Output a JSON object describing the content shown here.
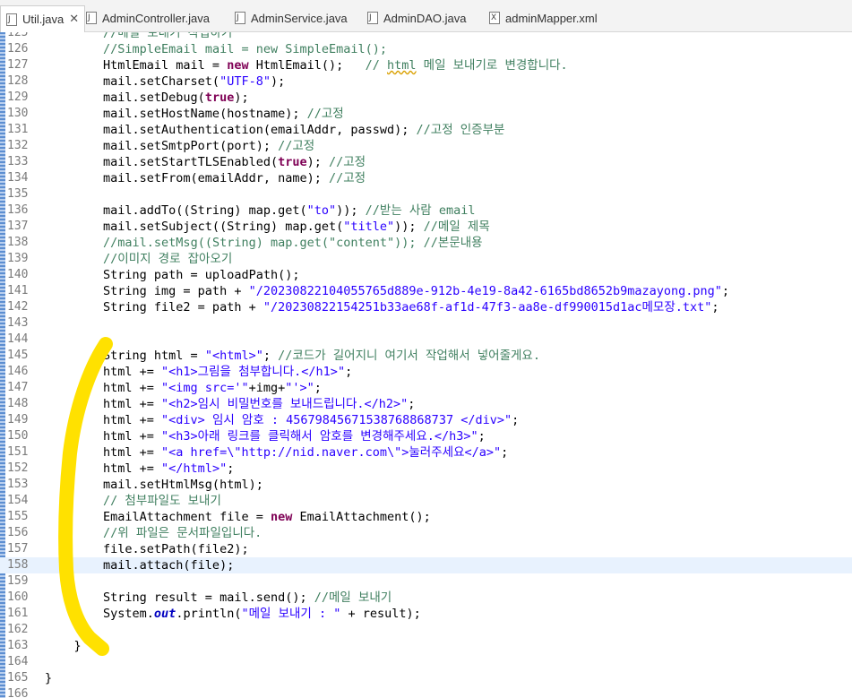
{
  "tabs": [
    {
      "label": "Util.java",
      "icon": "java-file-icon",
      "active": true
    },
    {
      "label": "AdminController.java",
      "icon": "java-file-icon"
    },
    {
      "label": "AdminService.java",
      "icon": "java-file-icon"
    },
    {
      "label": "AdminDAO.java",
      "icon": "java-file-icon"
    },
    {
      "label": "adminMapper.xml",
      "icon": "xml-file-icon"
    }
  ],
  "tab_close_glyph": "✕",
  "annotation": {
    "color": "#ffe100",
    "type": "freehand-yellow-arc"
  },
  "lines": [
    {
      "n": "125",
      "t": "        //메일 보내기 작업하기"
    },
    {
      "n": "126",
      "t": "        //SimpleEmail mail = new SimpleEmail();"
    },
    {
      "n": "127",
      "t": "        HtmlEmail mail = new HtmlEmail();   // html 메일 보내기로 변경합니다."
    },
    {
      "n": "128",
      "t": "        mail.setCharset(\"UTF-8\");"
    },
    {
      "n": "129",
      "t": "        mail.setDebug(true);"
    },
    {
      "n": "130",
      "t": "        mail.setHostName(hostname); //고정"
    },
    {
      "n": "131",
      "t": "        mail.setAuthentication(emailAddr, passwd); //고정 인증부분"
    },
    {
      "n": "132",
      "t": "        mail.setSmtpPort(port); //고정"
    },
    {
      "n": "133",
      "t": "        mail.setStartTLSEnabled(true); //고정"
    },
    {
      "n": "134",
      "t": "        mail.setFrom(emailAddr, name); //고정"
    },
    {
      "n": "135",
      "t": ""
    },
    {
      "n": "136",
      "t": "        mail.addTo((String) map.get(\"to\")); //받는 사람 email"
    },
    {
      "n": "137",
      "t": "        mail.setSubject((String) map.get(\"title\")); //메일 제목"
    },
    {
      "n": "138",
      "t": "        //mail.setMsg((String) map.get(\"content\")); //본문내용"
    },
    {
      "n": "139",
      "t": "        //이미지 경로 잡아오기"
    },
    {
      "n": "140",
      "t": "        String path = uploadPath();"
    },
    {
      "n": "141",
      "t": "        String img = path + \"/20230822104055765d889e-912b-4e19-8a42-6165bd8652b9mazayong.png\";"
    },
    {
      "n": "142",
      "t": "        String file2 = path + \"/20230822154251b33ae68f-af1d-47f3-aa8e-df990015d1ac메모장.txt\";"
    },
    {
      "n": "143",
      "t": ""
    },
    {
      "n": "144",
      "t": ""
    },
    {
      "n": "145",
      "t": "        String html = \"<html>\"; //코드가 길어지니 여기서 작업해서 넣어줄게요."
    },
    {
      "n": "146",
      "t": "        html += \"<h1>그림을 첨부합니다.</h1>\";"
    },
    {
      "n": "147",
      "t": "        html += \"<img src='\"+img+\"'>\";"
    },
    {
      "n": "148",
      "t": "        html += \"<h2>임시 비밀번호를 보내드립니다.</h2>\";"
    },
    {
      "n": "149",
      "t": "        html += \"<div> 임시 암호 : 45679845671538768868737 </div>\";"
    },
    {
      "n": "150",
      "t": "        html += \"<h3>아래 링크를 클릭해서 암호를 변경해주세요.</h3>\";"
    },
    {
      "n": "151",
      "t": "        html += \"<a href=\\\"http://nid.naver.com\\\">눌러주세요</a>\";"
    },
    {
      "n": "152",
      "t": "        html += \"</html>\";"
    },
    {
      "n": "153",
      "t": "        mail.setHtmlMsg(html);"
    },
    {
      "n": "154",
      "t": "        // 첨부파일도 보내기"
    },
    {
      "n": "155",
      "t": "        EmailAttachment file = new EmailAttachment();"
    },
    {
      "n": "156",
      "t": "        //위 파일은 문서파일입니다."
    },
    {
      "n": "157",
      "t": "        file.setPath(file2);"
    },
    {
      "n": "158",
      "t": "        mail.attach(file);",
      "current": true
    },
    {
      "n": "159",
      "t": ""
    },
    {
      "n": "160",
      "t": "        String result = mail.send(); //메일 보내기"
    },
    {
      "n": "161",
      "t": "        System.out.println(\"메일 보내기 : \" + result);"
    },
    {
      "n": "162",
      "t": ""
    },
    {
      "n": "163",
      "t": "    }"
    },
    {
      "n": "164",
      "t": ""
    },
    {
      "n": "165",
      "t": "}"
    },
    {
      "n": "166",
      "t": ""
    }
  ]
}
